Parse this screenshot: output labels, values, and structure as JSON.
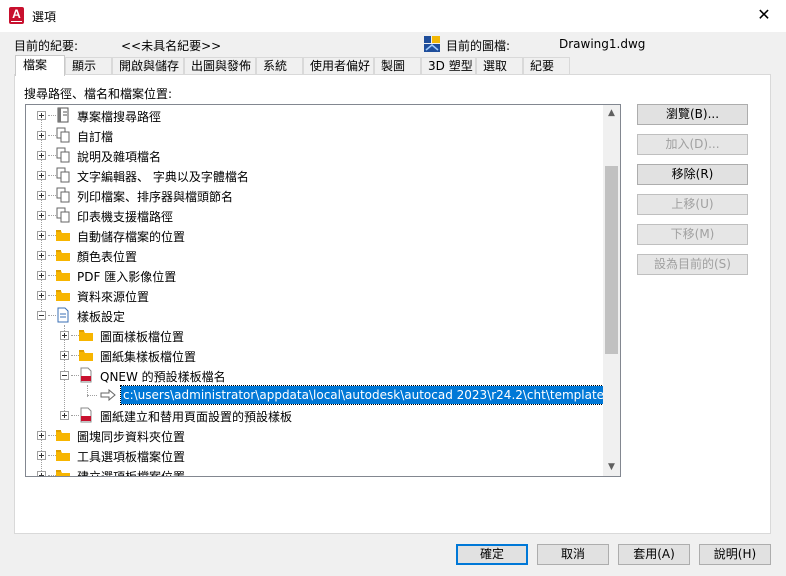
{
  "window": {
    "title": "選項",
    "close_glyph": "✕",
    "app_icon_letter": "A"
  },
  "info": {
    "profile_label": "目前的紀要:",
    "profile_value": "<<未具名紀要>>",
    "drawing_label": "目前的圖檔:",
    "drawing_value": "Drawing1.dwg"
  },
  "tabs": [
    {
      "label": "檔案",
      "active": true
    },
    {
      "label": "顯示",
      "active": false
    },
    {
      "label": "開啟與儲存",
      "active": false
    },
    {
      "label": "出圖與發佈",
      "active": false
    },
    {
      "label": "系統",
      "active": false
    },
    {
      "label": "使用者偏好",
      "active": false
    },
    {
      "label": "製圖",
      "active": false
    },
    {
      "label": "3D 塑型",
      "active": false
    },
    {
      "label": "選取",
      "active": false
    },
    {
      "label": "紀要",
      "active": false
    }
  ],
  "panel": {
    "label": "搜尋路徑、檔名和檔案位置:"
  },
  "tree": {
    "items": [
      {
        "label": "專案檔搜尋路徑",
        "icon": "book-icon",
        "level": 0,
        "expander": "plus"
      },
      {
        "label": "自訂檔",
        "icon": "pages-icon",
        "level": 0,
        "expander": "plus"
      },
      {
        "label": "說明及雜項檔名",
        "icon": "pages-icon",
        "level": 0,
        "expander": "plus"
      },
      {
        "label": "文字編輯器、 字典以及字體檔名",
        "icon": "pages-icon",
        "level": 0,
        "expander": "plus"
      },
      {
        "label": "列印檔案、排序器與檔頭節名",
        "icon": "pages-icon",
        "level": 0,
        "expander": "plus"
      },
      {
        "label": "印表機支援檔路徑",
        "icon": "pages-icon",
        "level": 0,
        "expander": "plus"
      },
      {
        "label": "自動儲存檔案的位置",
        "icon": "folder-icon",
        "level": 0,
        "expander": "plus"
      },
      {
        "label": "顏色表位置",
        "icon": "folder-icon",
        "level": 0,
        "expander": "plus"
      },
      {
        "label": "PDF 匯入影像位置",
        "icon": "folder-icon",
        "level": 0,
        "expander": "plus"
      },
      {
        "label": "資料來源位置",
        "icon": "folder-icon",
        "level": 0,
        "expander": "plus"
      },
      {
        "label": "樣板設定",
        "icon": "template-page-icon",
        "level": 0,
        "expander": "minus"
      },
      {
        "label": "圖面樣板檔位置",
        "icon": "folder-icon",
        "level": 1,
        "expander": "plus"
      },
      {
        "label": "圖紙集樣板檔位置",
        "icon": "folder-icon",
        "level": 1,
        "expander": "plus"
      },
      {
        "label": "QNEW 的預設樣板檔名",
        "icon": "dwt-file-icon",
        "level": 1,
        "expander": "minus"
      },
      {
        "label": "c:\\users\\administrator\\appdata\\local\\autodesk\\autocad 2023\\r24.2\\cht\\template\\acad.dwt",
        "icon": "arrow-right-icon",
        "level": 2,
        "expander": "none",
        "selected": true
      },
      {
        "label": "圖紙建立和替用頁面設置的預設樣板",
        "icon": "dwt-file-icon",
        "level": 1,
        "expander": "plus"
      },
      {
        "label": "圖塊同步資料夾位置",
        "icon": "folder-icon",
        "level": 0,
        "expander": "plus"
      },
      {
        "label": "工具選項板檔案位置",
        "icon": "folder-icon",
        "level": 0,
        "expander": "plus"
      },
      {
        "label": "建立選項板檔案位置",
        "icon": "folder-icon",
        "level": 0,
        "expander": "plus"
      }
    ]
  },
  "side_buttons": [
    {
      "label": "瀏覽(B)...",
      "enabled": true
    },
    {
      "label": "加入(D)...",
      "enabled": false
    },
    {
      "label": "移除(R)",
      "enabled": true
    },
    {
      "label": "上移(U)",
      "enabled": false
    },
    {
      "label": "下移(M)",
      "enabled": false
    },
    {
      "label": "設為目前的(S)",
      "enabled": false
    }
  ],
  "footer_buttons": [
    {
      "label": "確定",
      "default": true
    },
    {
      "label": "取消",
      "default": false
    },
    {
      "label": "套用(A)",
      "default": false
    },
    {
      "label": "說明(H)",
      "default": false
    }
  ],
  "colors": {
    "selection": "#0078d7",
    "folder": "#f7b500",
    "autocad_red": "#c8102e",
    "dwt_red": "#c8102e"
  }
}
